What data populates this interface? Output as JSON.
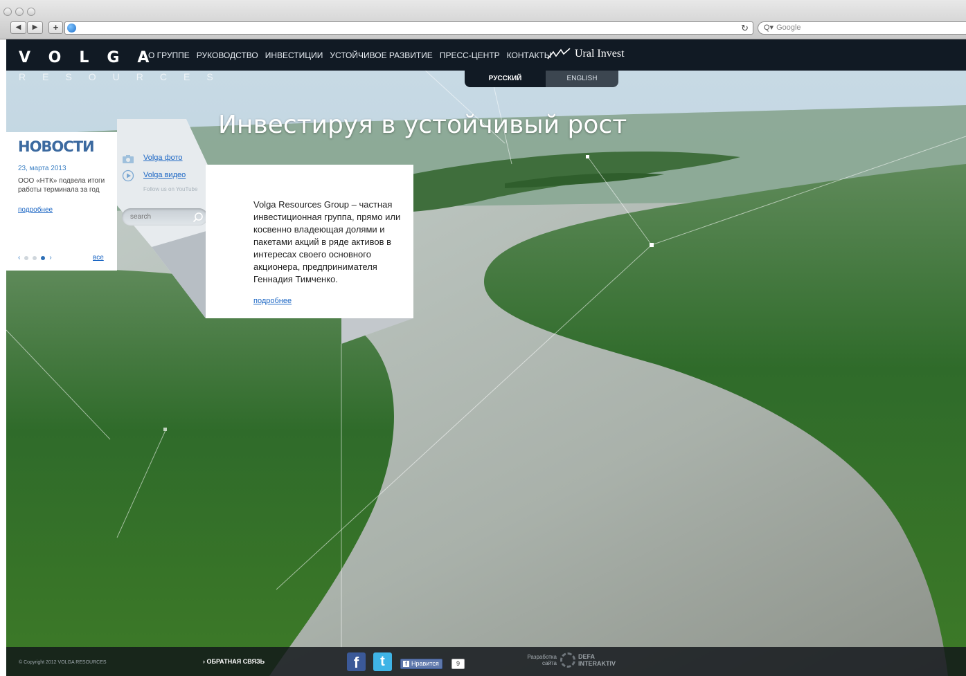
{
  "browser": {
    "search_placeholder": "Google",
    "back_label": "◀",
    "forward_label": "▶",
    "add_label": "+",
    "reload_label": "↻"
  },
  "site": {
    "logo": "VOLGA",
    "logo_sub": "RESOURCES",
    "nav": [
      {
        "label": "О ГРУППЕ"
      },
      {
        "label": "РУКОВОДСТВО"
      },
      {
        "label": "ИНВЕСТИЦИИ"
      },
      {
        "label": "УСТОЙЧИВОЕ РАЗВИТИЕ"
      },
      {
        "label": "ПРЕСС-ЦЕНТР"
      },
      {
        "label": "КОНТАКТЫ"
      }
    ],
    "partner": "Ural Invest",
    "lang": {
      "ru": "РУССКИЙ",
      "en": "ENGLISH"
    },
    "headline": "Инвестируя в устойчивый рост"
  },
  "news": {
    "title": "НОВОСТИ",
    "date": "23, марта 2013",
    "text": "ООО «НТК» подвела итоги работы терминала за год",
    "more": "подробнее",
    "all": "все",
    "prev": "‹",
    "next": "›"
  },
  "media": {
    "photo": "Volga фото",
    "video": "Volga видео",
    "follow": "Follow us on YouTube",
    "search_placeholder": "search"
  },
  "about": {
    "text": "Volga Resources Group – частная инвестиционная группа, прямо или косвенно владеющая долями и пакетами акций в ряде активов в интересах своего основного акционера, предпринимателя Геннадия Тимченко.",
    "more": "подробнее"
  },
  "footer": {
    "copyright": "© Copyright 2012 VOLGA RESOURCES",
    "feedback": "› ОБРАТНАЯ СВЯЗЬ",
    "like_label": "Нравится",
    "like_count": "9",
    "dev_label": "Разработка сайта",
    "dev_name_1": "DEFA",
    "dev_name_2": "INTERAKTIV"
  },
  "colors": {
    "topbar": "#111a24",
    "accent_blue": "#3c6aa0",
    "link": "#1b66c4"
  }
}
